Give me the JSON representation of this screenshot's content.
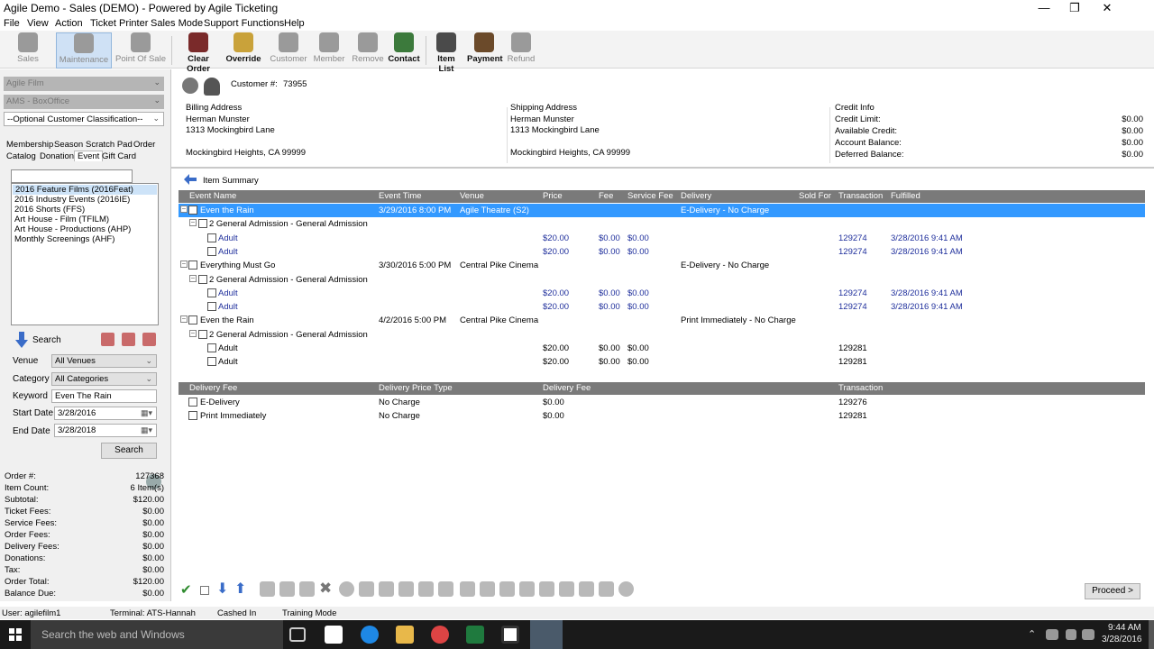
{
  "window": {
    "title": "Agile Demo - Sales (DEMO) - Powered by Agile Ticketing"
  },
  "menu": [
    "File",
    "View",
    "Action",
    "Ticket Printer",
    "Sales Mode",
    "Support Functions",
    "Help"
  ],
  "toolbar": {
    "sales": "Sales",
    "maintenance": "Maintenance",
    "pos": "Point Of Sale",
    "clear_order": "Clear Order",
    "override": "Override",
    "customer": "Customer",
    "member": "Member",
    "remove": "Remove",
    "contact": "Contact",
    "item_list": "Item List",
    "payment": "Payment",
    "refund": "Refund"
  },
  "left": {
    "org": "Agile Film",
    "office": "AMS - BoxOffice",
    "classification": "--Optional Customer Classification--",
    "tabs_row1": [
      "Membership",
      "Season",
      "Scratch Pad",
      "Order"
    ],
    "tabs_row2": [
      "Catalog",
      "Donation",
      "Event",
      "Gift Card"
    ],
    "series": [
      "2016 Feature Films  (2016Feat)",
      "2016 Industry Events  (2016IE)",
      "2016 Shorts  (FFS)",
      "Art House - Film  (TFILM)",
      "Art House - Productions  (AHP)",
      "Monthly Screenings  (AHF)"
    ],
    "search_label": "Search",
    "filters": {
      "venue_label": "Venue",
      "venue_value": "All Venues",
      "category_label": "Category",
      "category_value": "All Categories",
      "keyword_label": "Keyword",
      "keyword_value": "Even The Rain",
      "start_label": "Start Date",
      "start_value": "3/28/2016",
      "end_label": "End Date",
      "end_value": "3/28/2018"
    },
    "search_button": "Search",
    "summary": [
      {
        "k": "Order #:",
        "v": "127368"
      },
      {
        "k": "Item Count:",
        "v": "6 Item(s)"
      },
      {
        "k": "Subtotal:",
        "v": "$120.00"
      },
      {
        "k": "Ticket Fees:",
        "v": "$0.00"
      },
      {
        "k": "Service Fees:",
        "v": "$0.00"
      },
      {
        "k": "Order Fees:",
        "v": "$0.00"
      },
      {
        "k": "Delivery Fees:",
        "v": "$0.00"
      },
      {
        "k": "Donations:",
        "v": "$0.00"
      },
      {
        "k": "Tax:",
        "v": "$0.00"
      },
      {
        "k": "Order Total:",
        "v": "$120.00"
      },
      {
        "k": "Balance Due:",
        "v": "$0.00"
      }
    ]
  },
  "customer": {
    "number_label": "Customer #:",
    "number": "73955",
    "billing_label": "Billing Address",
    "billing": [
      "Herman Munster",
      "1313 Mockingbird Lane",
      "",
      "Mockingbird Heights, CA 99999"
    ],
    "shipping_label": "Shipping Address",
    "shipping": [
      "Herman Munster",
      "1313 Mockingbird Lane",
      "",
      "Mockingbird Heights, CA 99999"
    ],
    "credit_label": "Credit Info",
    "credit": [
      {
        "k": "Credit Limit:",
        "v": "$0.00"
      },
      {
        "k": "Available Credit:",
        "v": "$0.00"
      },
      {
        "k": "Account Balance:",
        "v": "$0.00"
      },
      {
        "k": "Deferred Balance:",
        "v": "$0.00"
      }
    ]
  },
  "item_summary": "Item Summary",
  "items_header": [
    "Event Name",
    "Event Time",
    "Venue",
    "Price",
    "Fee",
    "Service Fee",
    "Delivery",
    "Sold For",
    "Transaction",
    "Fulfilled"
  ],
  "items": [
    {
      "kind": "event",
      "sel": true,
      "name": "Even the Rain",
      "time": "3/29/2016 8:00 PM",
      "venue": "Agile Theatre (S2)",
      "delivery": "E-Delivery - No Charge"
    },
    {
      "kind": "group",
      "name": "2 General Admission - General Admission"
    },
    {
      "kind": "ticket",
      "blue": true,
      "name": "Adult",
      "price": "$20.00",
      "fee": "$0.00",
      "svc": "$0.00",
      "txn": "129274",
      "ful": "3/28/2016 9:41 AM"
    },
    {
      "kind": "ticket",
      "blue": true,
      "name": "Adult",
      "price": "$20.00",
      "fee": "$0.00",
      "svc": "$0.00",
      "txn": "129274",
      "ful": "3/28/2016 9:41 AM"
    },
    {
      "kind": "event",
      "name": "Everything Must Go",
      "time": "3/30/2016 5:00 PM",
      "venue": "Central Pike Cinema",
      "delivery": "E-Delivery - No Charge"
    },
    {
      "kind": "group",
      "name": "2 General Admission - General Admission"
    },
    {
      "kind": "ticket",
      "blue": true,
      "name": "Adult",
      "price": "$20.00",
      "fee": "$0.00",
      "svc": "$0.00",
      "txn": "129274",
      "ful": "3/28/2016 9:41 AM"
    },
    {
      "kind": "ticket",
      "blue": true,
      "name": "Adult",
      "price": "$20.00",
      "fee": "$0.00",
      "svc": "$0.00",
      "txn": "129274",
      "ful": "3/28/2016 9:41 AM"
    },
    {
      "kind": "event",
      "name": "Even the Rain",
      "time": "4/2/2016 5:00 PM",
      "venue": "Central Pike Cinema",
      "delivery": "Print Immediately - No Charge"
    },
    {
      "kind": "group",
      "name": "2 General Admission - General Admission"
    },
    {
      "kind": "ticket",
      "name": "Adult",
      "price": "$20.00",
      "fee": "$0.00",
      "svc": "$0.00",
      "txn": "129281",
      "ful": ""
    },
    {
      "kind": "ticket",
      "name": "Adult",
      "price": "$20.00",
      "fee": "$0.00",
      "svc": "$0.00",
      "txn": "129281",
      "ful": ""
    }
  ],
  "delivery_header": [
    "Delivery Fee",
    "Delivery Price Type",
    "Delivery Fee",
    "Transaction"
  ],
  "delivery_rows": [
    {
      "name": "E-Delivery",
      "type": "No Charge",
      "fee": "$0.00",
      "txn": "129276"
    },
    {
      "name": "Print Immediately",
      "type": "No Charge",
      "fee": "$0.00",
      "txn": "129281"
    }
  ],
  "proceed": "Proceed >",
  "status": {
    "user": "User:  agilefilm1",
    "terminal": "Terminal:  ATS-Hannah",
    "cashed": "Cashed In",
    "mode": "Training Mode"
  },
  "taskbar": {
    "search": "Search the web and Windows",
    "time": "9:44 AM",
    "date": "3/28/2016"
  },
  "colors": {
    "selection": "#3399ff",
    "grid_header": "#7a7a7a",
    "link_blue": "#1f2f9c"
  }
}
